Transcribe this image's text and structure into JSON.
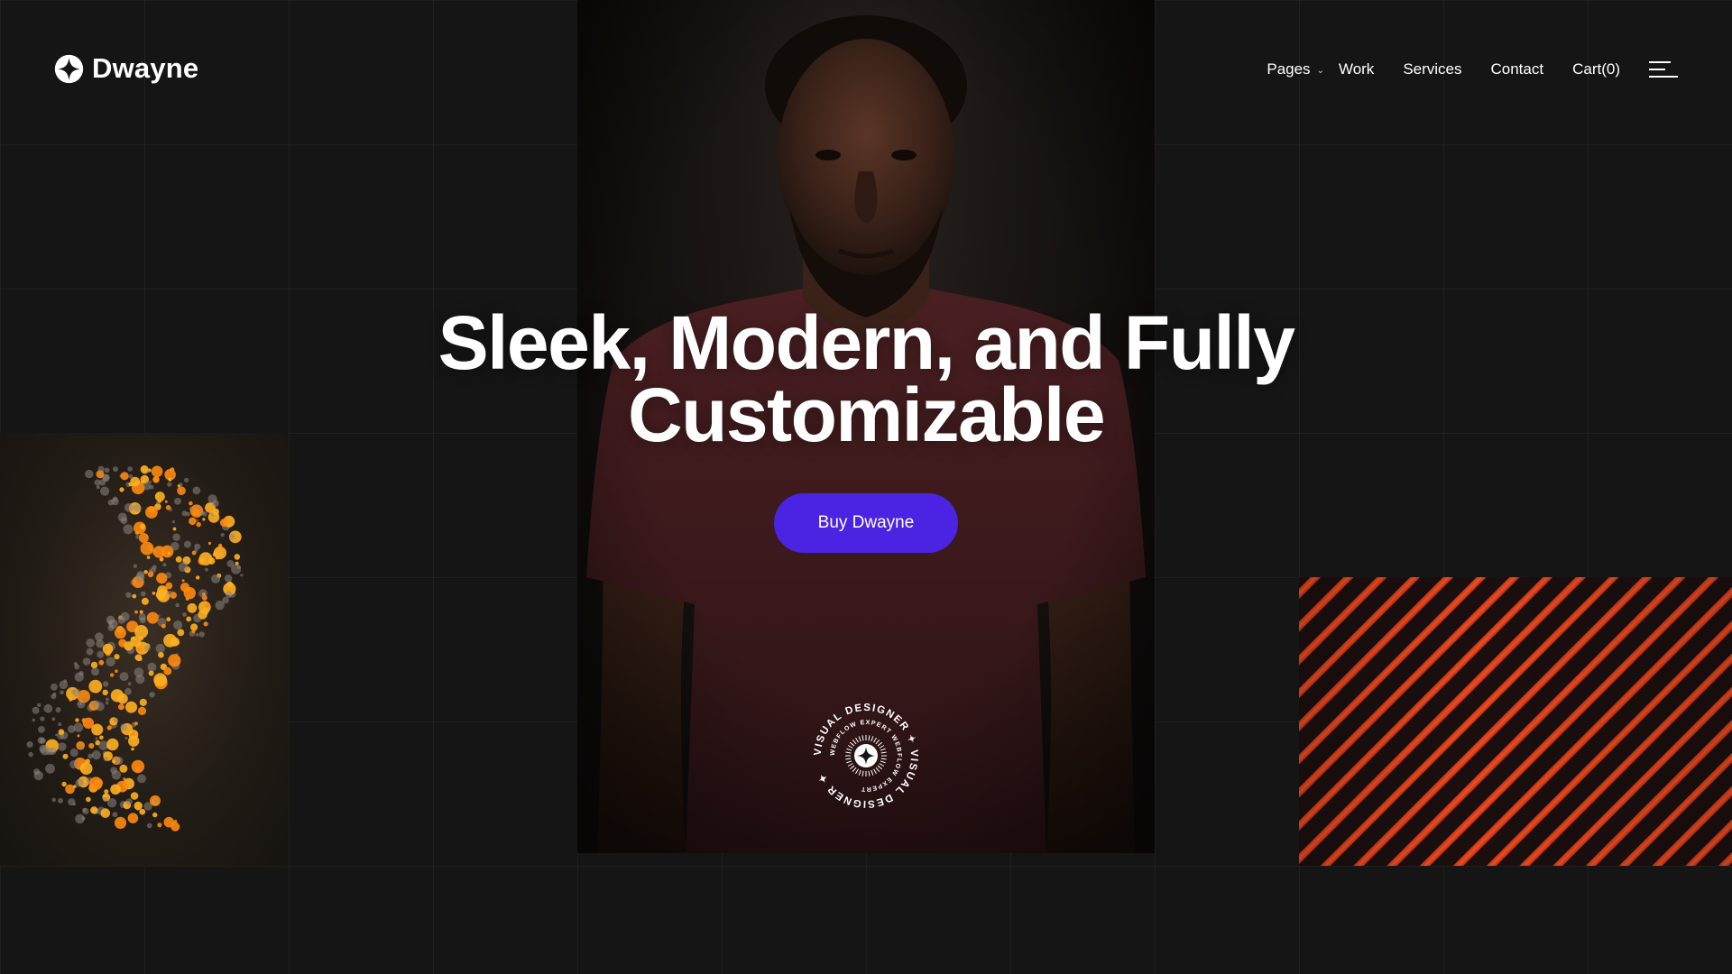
{
  "brand": {
    "name": "Dwayne",
    "logo_icon": "four-point-star-icon"
  },
  "nav": {
    "items": [
      {
        "label": "Pages",
        "has_dropdown": true,
        "icon": "chevron-down-icon"
      },
      {
        "label": "Work"
      },
      {
        "label": "Services"
      },
      {
        "label": "Contact"
      },
      {
        "label": "Cart(0)"
      }
    ],
    "menu_icon": "hamburger-menu-icon"
  },
  "hero": {
    "title_line1": "Sleek, Modern, and Fully",
    "title_line2": "Customizable",
    "cta_label": "Buy Dwayne",
    "cta_color": "#4b24e3"
  },
  "badge": {
    "outer_text": "VISUAL DESIGNER ✦ VISUAL DESIGNER ✦ ",
    "inner_text": "WEBFLOW EXPERT WEBFLOW EXPERT "
  },
  "colors": {
    "background": "#151515",
    "accent": "#4b24e3",
    "stripe": "#f0501e"
  }
}
